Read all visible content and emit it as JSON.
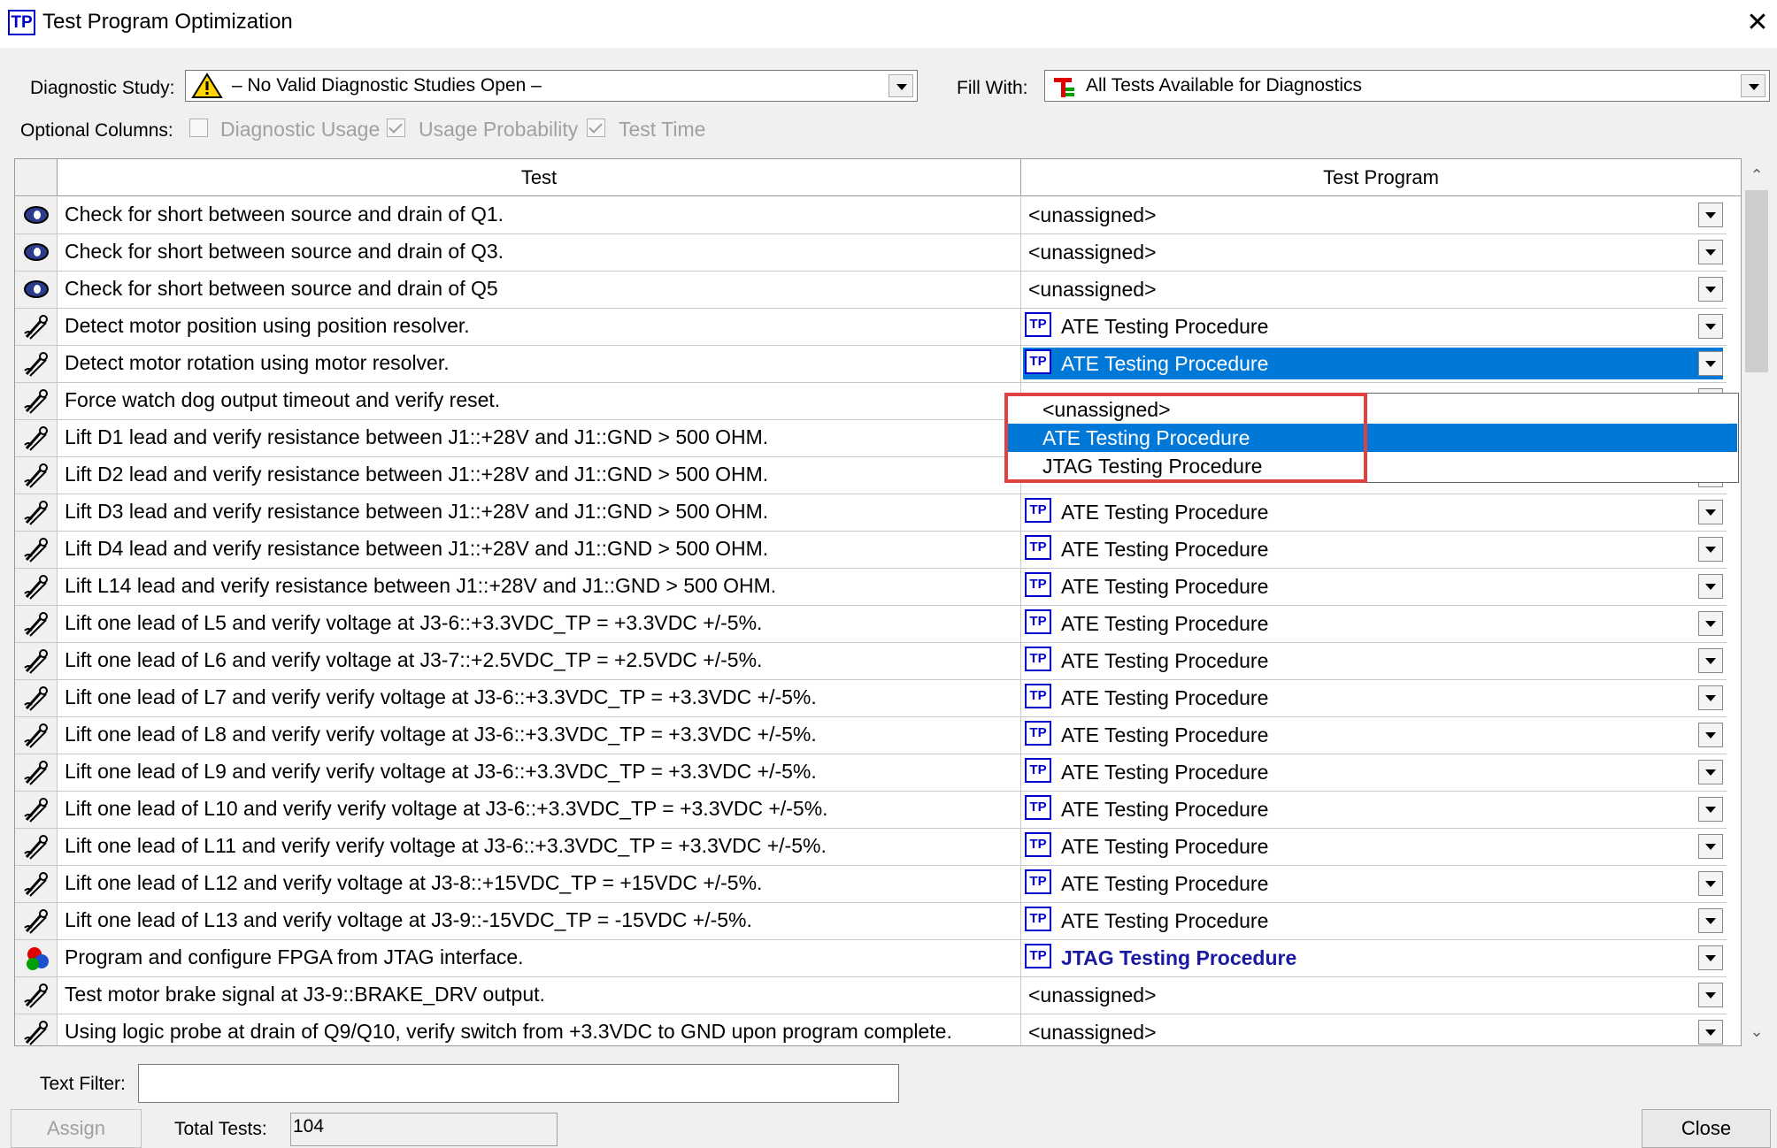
{
  "window": {
    "title": "Test Program Optimization",
    "app_icon": "TP",
    "close_glyph": "✕"
  },
  "controls": {
    "diagnostic_label": "Diagnostic Study:",
    "diagnostic_value": "– No Valid Diagnostic Studies Open –",
    "fill_label": "Fill With:",
    "fill_value": "All Tests Available for Diagnostics",
    "optional_label": "Optional Columns:",
    "optional_columns": [
      {
        "label": "Diagnostic Usage",
        "checked": false
      },
      {
        "label": "Usage Probability",
        "checked": true
      },
      {
        "label": "Test Time",
        "checked": true
      }
    ]
  },
  "grid": {
    "columns": [
      "Test",
      "Test Program"
    ],
    "rows": [
      {
        "icon": "eye-icon",
        "test": "Check for short between source and drain of Q1.",
        "program": "<unassigned>"
      },
      {
        "icon": "eye-icon",
        "test": "Check for short between source and drain of Q3.",
        "program": "<unassigned>"
      },
      {
        "icon": "eye-icon",
        "test": "Check for short between source and drain of Q5",
        "program": "<unassigned>"
      },
      {
        "icon": "probe-icon",
        "test": "Detect motor position using position resolver.",
        "program": "ATE Testing Procedure"
      },
      {
        "icon": "probe-icon",
        "test": "Detect motor rotation using motor resolver.",
        "program": "ATE Testing Procedure",
        "selected": true
      },
      {
        "icon": "probe-icon",
        "test": "Force watch dog output timeout and verify reset.",
        "program": ""
      },
      {
        "icon": "probe-icon",
        "test": "Lift D1 lead and verify resistance between J1::+28V and J1::GND > 500 OHM.",
        "program": ""
      },
      {
        "icon": "probe-icon",
        "test": "Lift D2 lead and verify resistance between J1::+28V and J1::GND > 500 OHM.",
        "program": ""
      },
      {
        "icon": "probe-icon",
        "test": "Lift D3 lead and verify resistance between J1::+28V and J1::GND > 500 OHM.",
        "program": "ATE Testing Procedure"
      },
      {
        "icon": "probe-icon",
        "test": "Lift D4 lead and verify resistance between J1::+28V and J1::GND > 500 OHM.",
        "program": "ATE Testing Procedure"
      },
      {
        "icon": "probe-icon",
        "test": "Lift L14 lead and verify resistance between J1::+28V and J1::GND > 500 OHM.",
        "program": "ATE Testing Procedure"
      },
      {
        "icon": "probe-icon",
        "test": "Lift one lead of L5 and verify voltage at J3-6::+3.3VDC_TP = +3.3VDC +/-5%.",
        "program": "ATE Testing Procedure"
      },
      {
        "icon": "probe-icon",
        "test": "Lift one lead of L6 and verify voltage at J3-7::+2.5VDC_TP = +2.5VDC +/-5%.",
        "program": "ATE Testing Procedure"
      },
      {
        "icon": "probe-icon",
        "test": "Lift one lead of L7 and verify verify voltage at J3-6::+3.3VDC_TP = +3.3VDC +/-5%.",
        "program": "ATE Testing Procedure"
      },
      {
        "icon": "probe-icon",
        "test": "Lift one lead of L8 and verify verify voltage at J3-6::+3.3VDC_TP = +3.3VDC +/-5%.",
        "program": "ATE Testing Procedure"
      },
      {
        "icon": "probe-icon",
        "test": "Lift one lead of L9 and verify verify voltage at J3-6::+3.3VDC_TP = +3.3VDC +/-5%.",
        "program": "ATE Testing Procedure"
      },
      {
        "icon": "probe-icon",
        "test": "Lift one lead of L10 and verify verify voltage at J3-6::+3.3VDC_TP = +3.3VDC +/-5%.",
        "program": "ATE Testing Procedure"
      },
      {
        "icon": "probe-icon",
        "test": "Lift one lead of L11 and verify verify voltage at J3-6::+3.3VDC_TP = +3.3VDC +/-5%.",
        "program": "ATE Testing Procedure"
      },
      {
        "icon": "probe-icon",
        "test": "Lift one lead of L12 and verify voltage at J3-8::+15VDC_TP = +15VDC +/-5%.",
        "program": "ATE Testing Procedure"
      },
      {
        "icon": "probe-icon",
        "test": "Lift one lead of L13 and verify voltage at J3-9::-15VDC_TP = -15VDC +/-5%.",
        "program": "ATE Testing Procedure"
      },
      {
        "icon": "fpga-icon",
        "test": "Program and configure FPGA from JTAG interface.",
        "program": "JTAG Testing Procedure",
        "bold": true
      },
      {
        "icon": "probe-icon",
        "test": "Test motor brake signal at J3-9::BRAKE_DRV output.",
        "program": "<unassigned>"
      },
      {
        "icon": "probe-icon",
        "test": "Using logic probe at drain of Q9/Q10, verify switch from +3.3VDC to GND upon program complete.",
        "program": "<unassigned>"
      }
    ]
  },
  "dropdown": {
    "options": [
      "<unassigned>",
      "ATE Testing Procedure",
      "JTAG Testing Procedure"
    ],
    "selected_index": 1
  },
  "footer": {
    "text_filter_label": "Text Filter:",
    "text_filter_value": "",
    "assign_label": "Assign",
    "total_label": "Total Tests:",
    "total_value": "104",
    "close_label": "Close"
  },
  "colors": {
    "selection": "#0078d7",
    "highlight_box": "#e04040",
    "tp_icon": "#0000cc"
  }
}
